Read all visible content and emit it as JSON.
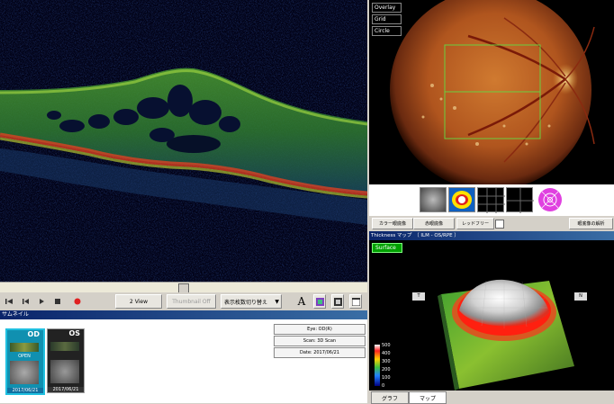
{
  "fundus": {
    "buttons": [
      "Overlay",
      "Grid",
      "Circle"
    ],
    "bottom_buttons": {
      "color_fundus": "カラー眼底像",
      "red_free_fundus": "赤眼底像",
      "red_free": "レッドフリー",
      "fundus_analysis": "眼底像の解析"
    }
  },
  "toolbar": {
    "two_view": "2 View",
    "thumbnail_off": "Thumbnail Off",
    "display_switch": "表示枚数切り替え"
  },
  "thumbnails": {
    "header": "サムネイル",
    "items": [
      {
        "eye": "OD",
        "status": "OPEN",
        "date": "2017/06/21"
      },
      {
        "eye": "OS",
        "status": "",
        "date": "2017/06/21"
      }
    ],
    "info": {
      "eye": "Eye: OD(R)",
      "scan": "Scan: 3D Scan",
      "date": "Date: 2017/06/21"
    }
  },
  "thickness": {
    "header": "Thickness マップ　（ ILM - OS/RPE ）",
    "surface_button": "Surface",
    "orientation_left": "T",
    "orientation_right": "N",
    "scale": [
      "500",
      "400",
      "300",
      "200",
      "100",
      "0"
    ],
    "tabs": [
      "グラフ",
      "マップ"
    ]
  },
  "colors": {
    "title_bar": "#0a246a",
    "surface_button": "#00a000",
    "record_button": "#e02020"
  }
}
